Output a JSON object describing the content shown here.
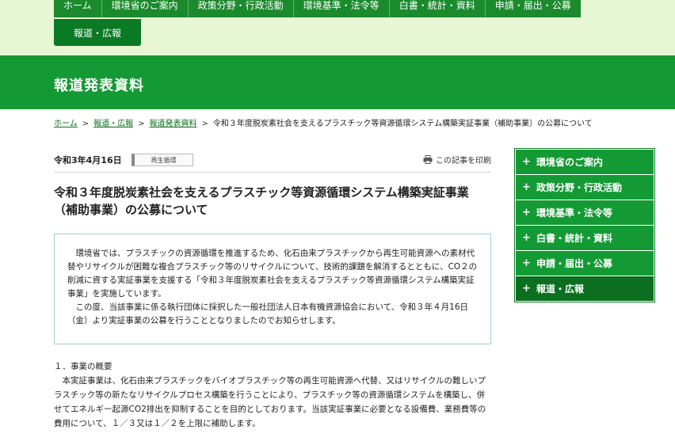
{
  "global_nav": {
    "items": [
      "ホーム",
      "環境省のご案内",
      "政策分野・行政活動",
      "環境基準・法令等",
      "白書・統計・資料",
      "申請・届出・公募"
    ],
    "row2": "報道・広報"
  },
  "banner": {
    "title": "報道発表資料"
  },
  "breadcrumb": {
    "items": [
      "ホーム",
      "報道・広報",
      "報道発表資料"
    ],
    "current": "令和３年度脱炭素社会を支えるプラスチック等資源循環システム構築実証事業（補助事業）の公募について"
  },
  "article": {
    "date": "令和3年4月16日",
    "tag": "再生循環",
    "print_label": "この記事を印刷",
    "title_line1": "令和３年度脱炭素社会を支えるプラスチック等資源循環システム構築実証事業",
    "title_line2": "（補助事業）の公募について",
    "notice_p1": "環境省では、プラスチックの資源循環を推進するため、化石由来プラスチックから再生可能資源への素材代替やリサイクルが困難な複合プラスチック等のリサイクルについて、技術的課題を解消するとともに、CO２の削減に資する実証事業を支援する「令和３年度脱炭素社会を支えるプラスチック等資源循環システム構築実証事業」を実施しています。",
    "notice_p2": "この度、当該事業に係る執行団体に採択した一般社団法人日本有機資源協会において、令和３年４月16日（金）より実証事業の公募を行うこととなりましたのでお知らせします。",
    "section1_heading": "１．事業の概要",
    "section1_body": "本実証事業は、化石由来プラスチックをバイオプラスチック等の再生可能資源へ代替、又はリサイクルの難しいプラスチック等の新たなリサイクルプロセス構築を行うことにより、プラスチック等の資源循環システムを構築し、併せてエネルギー起源CO2排出を抑制することを目的としております。当該実証事業に必要となる設備費、業務費等の費用について、１／３又は１／２を上限に補助します。"
  },
  "sidebar": {
    "items": [
      "環境省のご案内",
      "政策分野・行政活動",
      "環境基準・法令等",
      "白書・統計・資料",
      "申請・届出・公募",
      "報道・広報"
    ],
    "plus": "+"
  },
  "colors": {
    "brand_green": "#149a34",
    "dark_green": "#0b6f1f",
    "top_bg": "#e8f7d3",
    "link": "#0a6e1e"
  }
}
